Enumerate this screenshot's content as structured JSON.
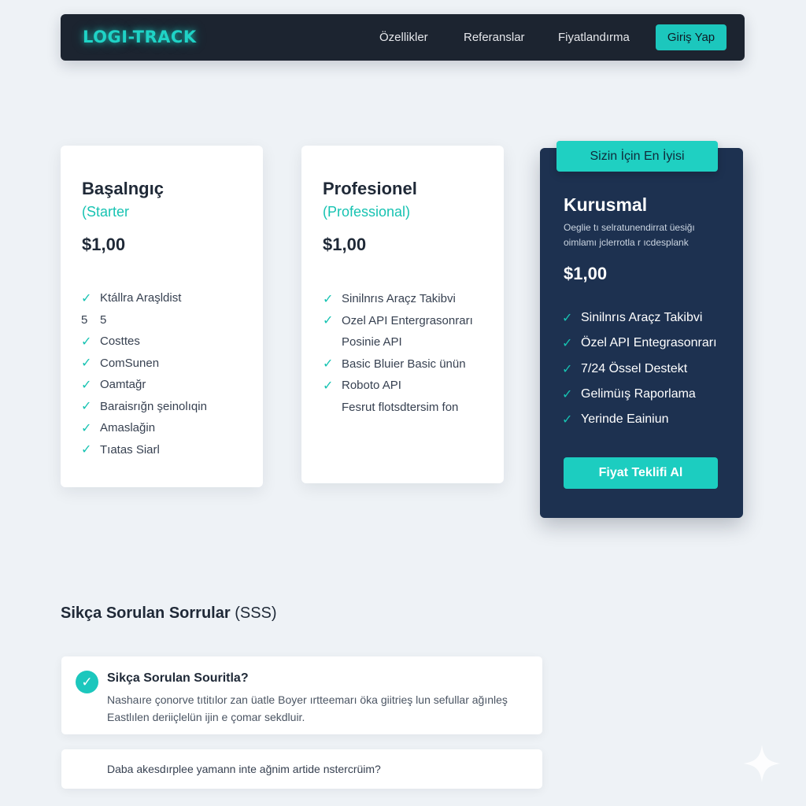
{
  "header": {
    "logo": "LOGI-TRACK",
    "nav": [
      "Özellikler",
      "Referanslar",
      "Fiyatlandırma"
    ],
    "login": "Giriş Yap"
  },
  "plans": {
    "starter": {
      "name": "Başalngıç",
      "subtitle": "(Starter",
      "price": "$1,00",
      "features": [
        {
          "marker": "check",
          "text": "Ktállra Araşldist"
        },
        {
          "marker": "5",
          "text": "5"
        },
        {
          "marker": "check",
          "text": "Costtes"
        },
        {
          "marker": "check",
          "text": "ComSunen"
        },
        {
          "marker": "check",
          "text": "Oamtağr"
        },
        {
          "marker": "check",
          "text": "Baraisrığn şeinolıqin"
        },
        {
          "marker": "check",
          "text": "Amaslağin"
        },
        {
          "marker": "check",
          "text": "Tıatas Siarl"
        }
      ]
    },
    "professional": {
      "name": "Profesionel",
      "subtitle": "(Professional)",
      "price": "$1,00",
      "features": [
        {
          "marker": "check",
          "text": "Sinilnrıs Araçz Takibvi"
        },
        {
          "marker": "check",
          "text": "Ozel API Entergrasonrarı"
        },
        {
          "marker": "none",
          "text": "Posinie API"
        },
        {
          "marker": "check",
          "text": "Basic Bluier Basic ünün"
        },
        {
          "marker": "check",
          "text": "Roboto API"
        },
        {
          "marker": "none",
          "text": "Fesrut flotsdtersim fon"
        }
      ]
    },
    "enterprise": {
      "badge": "Sizin İçin En İyisi",
      "name": "Kurusmal",
      "description": "Oeglie tı selratunendirrat üesiğı oimlamı jclerrotla r ıcdesplank",
      "price": "$1,00",
      "features": [
        "Sinilnrıs Araçz Takibvi",
        "Özel API Entegrasonrarı",
        "7/24 Össel Destekt",
        "Gelimüış Raporlama",
        "Yerinde Eainiun"
      ],
      "cta": "Fiyat Teklifi Al"
    }
  },
  "faq": {
    "title_main": "Sikça Sorulan Sorrular",
    "title_suffix": " (SSS)",
    "items": [
      {
        "question": "Sikça Sorulan Souritla?",
        "answer": "Nashaıre çonorve tıtitılor zan üatle Boyer ırtteemarı öka giitrieş lun sefullar ağınleş Eastlılen deriiçlelün ijin e çomar sekdluir."
      },
      {
        "question": "Daba akesdırplee yamann inte ağnim artide nstercrüim?"
      }
    ]
  },
  "colors": {
    "accent": "#1cc7bd",
    "navbar": "#1c2430",
    "enterprise_card": "#1d3150",
    "background": "#eef2f6"
  }
}
